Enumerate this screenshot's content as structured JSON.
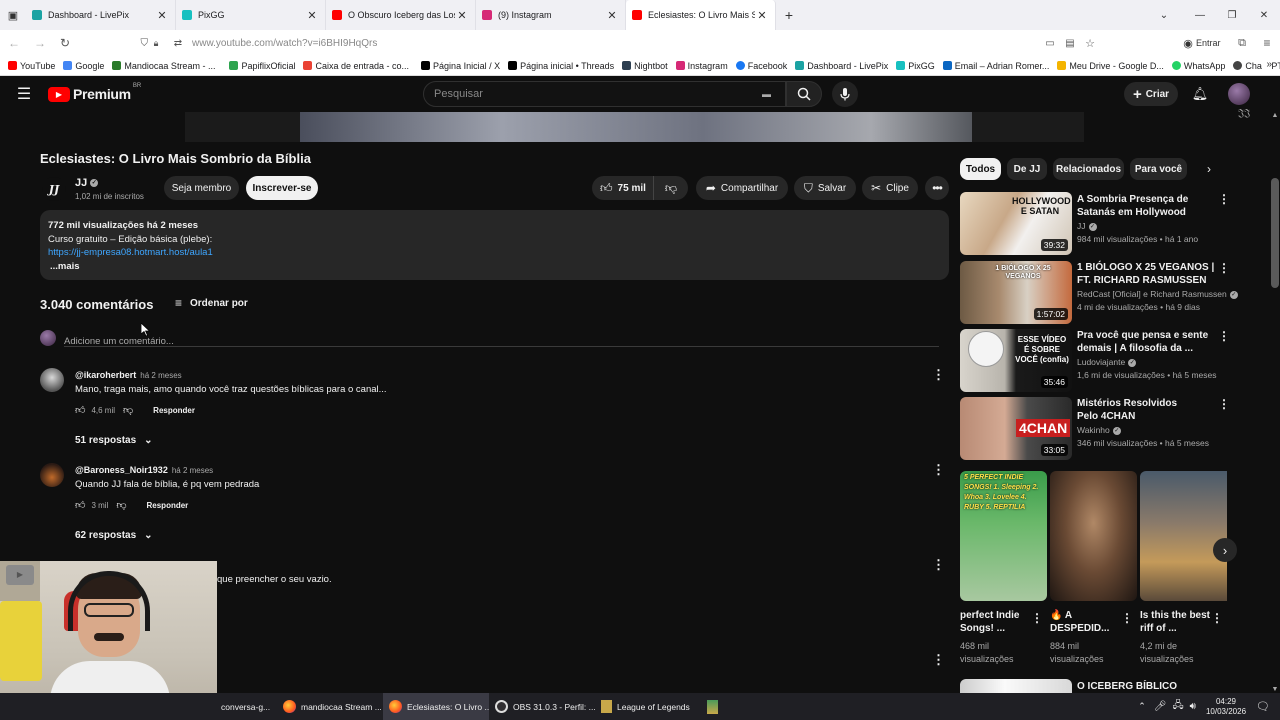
{
  "browser": {
    "tabs": [
      {
        "label": "Dashboard - LivePix",
        "color": "#1ba3a3"
      },
      {
        "label": "PixGG",
        "color": "#17c0c0"
      },
      {
        "label": "O Obscuro Iceberg das Lost Me",
        "color": "#ff0000"
      },
      {
        "label": "(9) Instagram",
        "color": "#d62976"
      },
      {
        "label": "Eclesiastes: O Livro Mais Sombri",
        "color": "#ff0000"
      }
    ],
    "url": "www.youtube.com/watch?v=i6BHI9HqQrs",
    "signin_label": "Entrar",
    "bookmarks": [
      {
        "label": "YouTube",
        "color": "#ff0000"
      },
      {
        "label": "Google",
        "color": "#4285f4"
      },
      {
        "label": "Mandiocaa Stream - ...",
        "color": "#2a7a2a"
      },
      {
        "label": "PapiflixOficial",
        "color": "#2ea44f"
      },
      {
        "label": "Caixa de entrada - co...",
        "color": "#ea4335"
      },
      {
        "label": "Página Inicial / X",
        "color": "#000000"
      },
      {
        "label": "Página inicial • Threads",
        "color": "#000000"
      },
      {
        "label": "Nightbot",
        "color": "#2c3e50"
      },
      {
        "label": "Instagram",
        "color": "#d62976"
      },
      {
        "label": "Facebook",
        "color": "#1877f2"
      },
      {
        "label": "Dashboard - LivePix",
        "color": "#1ba3a3"
      },
      {
        "label": "PixGG",
        "color": "#17c0c0"
      },
      {
        "label": "Email – Adrian Romer...",
        "color": "#0a66c2"
      },
      {
        "label": "Meu Drive - Google D...",
        "color": "#f4b400"
      },
      {
        "label": "WhatsApp",
        "color": "#25d366"
      },
      {
        "label": "ChatGPT - Roleta Com...",
        "color": "#444444"
      }
    ]
  },
  "youtube": {
    "logo_text": "Premium",
    "logo_region": "BR",
    "search_placeholder": "Pesquisar",
    "create_label": "Criar"
  },
  "video": {
    "title": "Eclesiastes: O Livro Mais Sombrio da Bíblia",
    "channel_name": "JJ",
    "channel_avatar_text": "JJ",
    "subscribers": "1,02 mi de inscritos",
    "join_label": "Seja membro",
    "subscribe_label": "Inscrever-se",
    "likes": "75 mil",
    "share_label": "Compartilhar",
    "save_label": "Salvar",
    "clip_label": "Clipe"
  },
  "description": {
    "meta": "772 mil visualizações  há 2 meses",
    "line1": "Curso gratuito – Edição básica (plebe):",
    "link": "https://jj-empresa08.hotmart.host/aula1",
    "more": "...mais"
  },
  "comments": {
    "count_label": "3.040 comentários",
    "sort_label": "Ordenar por",
    "add_placeholder": "Adicione um comentário...",
    "reply_label": "Responder",
    "items": [
      {
        "user": "@ikaroherbert",
        "time": "há 2 meses",
        "text": "Mano, traga mais, amo quando você traz questões bíblicas para o canal...",
        "likes": "4,6 mil",
        "replies": "51 respostas"
      },
      {
        "user": "@Baroness_Noir1932",
        "time": "há 2 meses",
        "text": "Quando JJ fala de bíblia, é pq vem pedrada",
        "likes": "3 mil",
        "replies": "62 respostas"
      },
      {
        "text": "que preencher o seu vazio."
      }
    ]
  },
  "sidebar": {
    "chips": [
      "Todos",
      "De JJ",
      "Relacionados",
      "Para você"
    ],
    "recommendations": [
      {
        "title": "A Sombria Presença de Satanás em Hollywood",
        "channel": "JJ",
        "meta": "984 mil visualizações • há 1 ano",
        "duration": "39:32",
        "thumb_text": "HOLLYWOOD E SATAN"
      },
      {
        "title": "1 BIÓLOGO X 25 VEGANOS | FT. RICHARD RASMUSSEN",
        "channel": "RedCast [Oficial] e Richard Rasmussen",
        "meta": "4 mi de visualizações • há 9 dias",
        "duration": "1:57:02",
        "thumb_text": "1 BIÓLOGO X 25 VEGANOS"
      },
      {
        "title": "Pra você que pensa e sente demais | A filosofia da ...",
        "channel": "Ludoviajante",
        "meta": "1,6 mi de visualizações • há 5 meses",
        "duration": "35:46",
        "thumb_text": "ESSE VÍDEO É SOBRE VOCÊ (confia)"
      },
      {
        "title": "Mistérios Resolvidos Pelo 4CHAN",
        "channel": "Wakinho",
        "meta": "346 mil visualizações • há 5 meses",
        "duration": "33:05",
        "thumb_text": "4CHAN"
      }
    ],
    "shorts": [
      {
        "title": "perfect Indie Songs! ...",
        "views": "468 mil visualizações",
        "thumb_text": "5 PERFECT INDIE SONGS! 1. Sleeping 2. Whoa 3. Lovelee 4. RUBY 5. REPTILIA"
      },
      {
        "title": "🔥 A DESPEDID...",
        "views": "884 mil visualizações"
      },
      {
        "title": "Is this the best riff of ...",
        "views": "4,2 mi de visualizações"
      }
    ],
    "last_title": "O ICEBERG BÍBLICO"
  },
  "taskbar": {
    "items": [
      {
        "label": "conversa-g..."
      },
      {
        "label": "mandiocaa Stream ..."
      },
      {
        "label": "Eclesiastes: O Livro ..."
      },
      {
        "label": "OBS 31.0.3 - Perfil: ..."
      },
      {
        "label": "League of Legends"
      }
    ],
    "time": "04:29",
    "date": "10/03/2026"
  }
}
